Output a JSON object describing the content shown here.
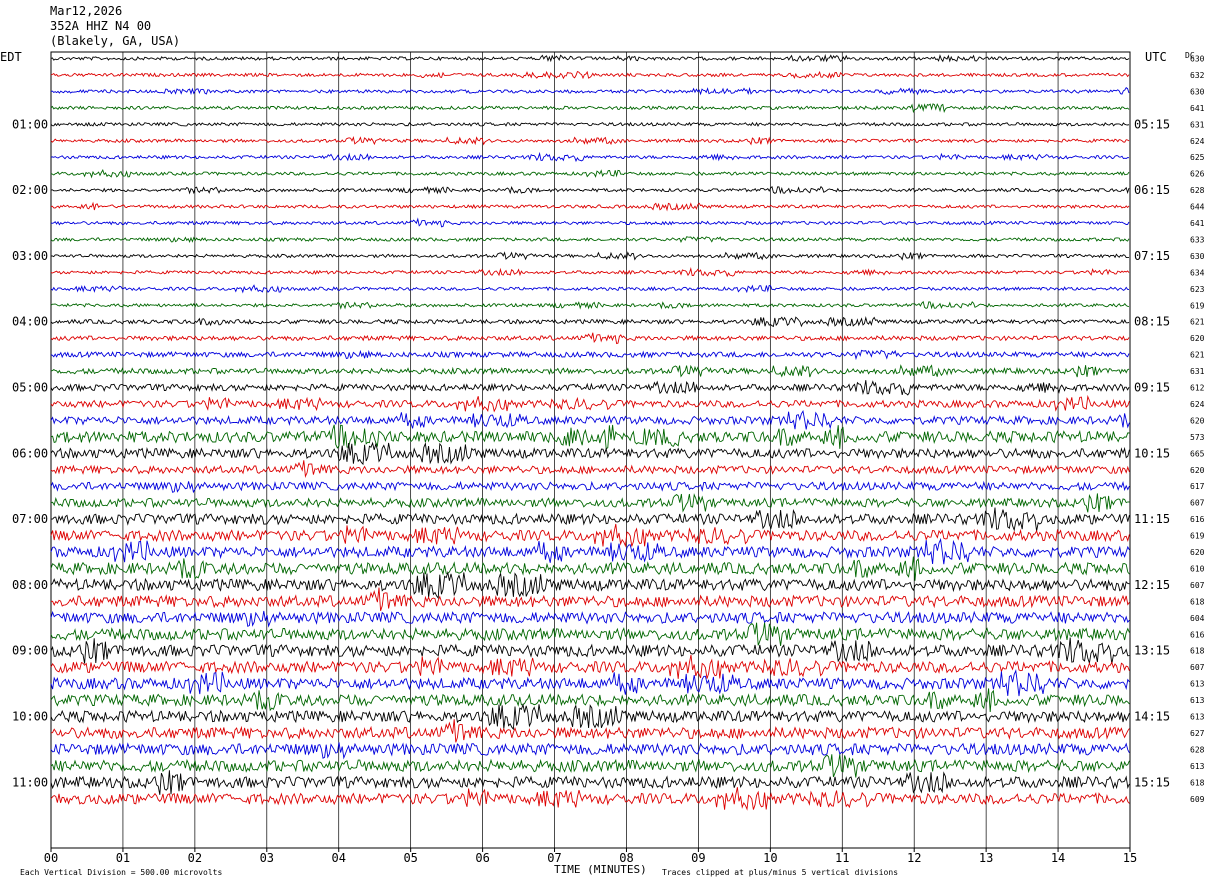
{
  "header": {
    "date": "Mar12,2026",
    "station": "352A HHZ N4 00",
    "location": "(Blakely, GA, USA)"
  },
  "labels": {
    "left_tz": "EDT",
    "right_tz": "UTC",
    "dc": "DC",
    "x_axis_title": "TIME (MINUTES)",
    "scale_note": "Each Vertical Division =  500.00 microvolts",
    "clip_note": "Traces clipped at plus/minus 5 vertical divisions"
  },
  "chart_data": {
    "type": "line",
    "title": "",
    "xlabel": "TIME (MINUTES)",
    "ylabel": "",
    "x_ticks": [
      "00",
      "01",
      "02",
      "03",
      "04",
      "05",
      "06",
      "07",
      "08",
      "09",
      "10",
      "11",
      "12",
      "13",
      "14",
      "15"
    ],
    "xlim": [
      0,
      15
    ],
    "grid": true,
    "trace_colors": [
      "#000000",
      "#dd0000",
      "#0000dd",
      "#006600"
    ],
    "left_time_labels": [
      "01:00",
      "02:00",
      "03:00",
      "04:00",
      "05:00",
      "06:00",
      "07:00",
      "08:00",
      "09:00",
      "10:00",
      "11:00"
    ],
    "right_time_labels": [
      "05:15",
      "06:15",
      "07:15",
      "08:15",
      "09:15",
      "10:15",
      "11:15",
      "12:15",
      "13:15",
      "14:15",
      "15:15"
    ],
    "dc_offsets": [
      "630",
      "632",
      "630",
      "641",
      "631",
      "624",
      "625",
      "626",
      "628",
      "644",
      "641",
      "633",
      "630",
      "634",
      "623",
      "619",
      "621",
      "620",
      "621",
      "631",
      "612",
      "624",
      "620",
      "573",
      "665",
      "620",
      "617",
      "607",
      "616",
      "619",
      "620",
      "610",
      "607",
      "618",
      "604",
      "616",
      "618",
      "607",
      "613",
      "613",
      "613",
      "627",
      "628",
      "613",
      "618",
      "609"
    ],
    "activity_levels": [
      1,
      1,
      1,
      1,
      1,
      1,
      1,
      1,
      1,
      1,
      1,
      1,
      1,
      1,
      1,
      1,
      1.3,
      1.4,
      1.6,
      1.7,
      2,
      2.2,
      2.5,
      3.5,
      3,
      2.4,
      2.5,
      2.7,
      3.2,
      3.3,
      3.4,
      3.6,
      3.6,
      3.5,
      3.5,
      3.6,
      3.6,
      3.5,
      3.5,
      3.5,
      3.5,
      3.5,
      3.6,
      3.6,
      3.5,
      3.3
    ]
  }
}
